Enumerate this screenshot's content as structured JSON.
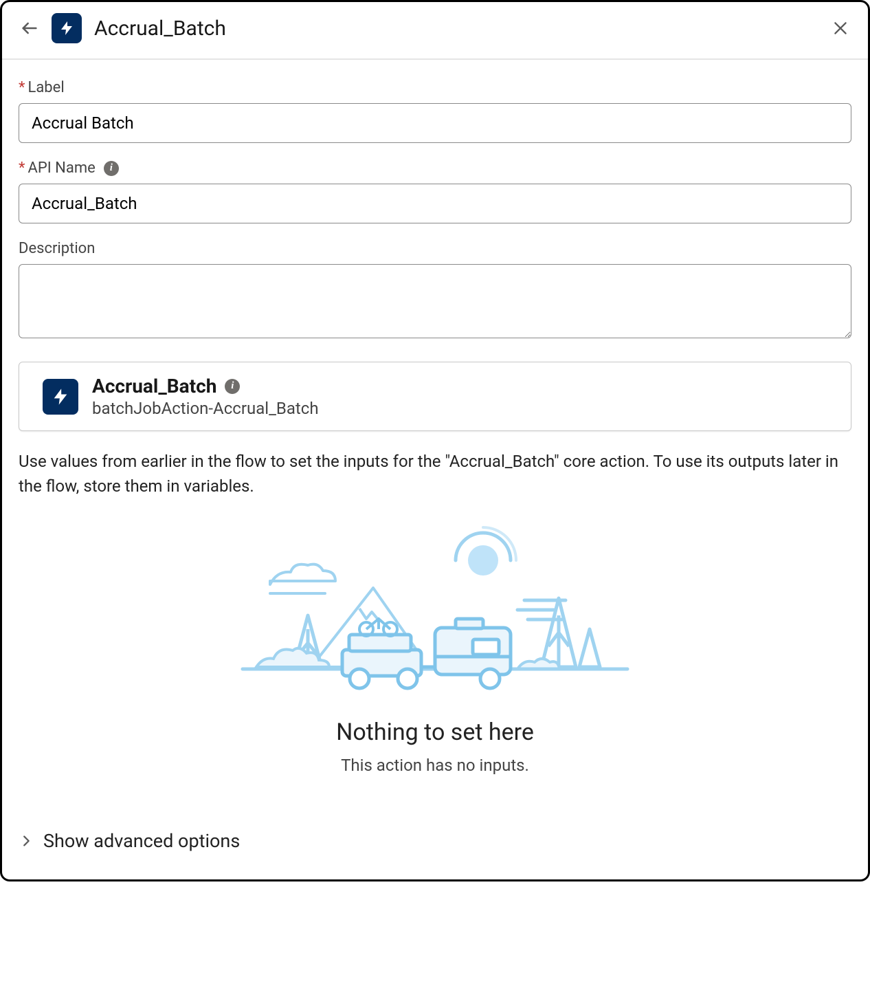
{
  "header": {
    "title": "Accrual_Batch"
  },
  "form": {
    "label": {
      "label": "Label",
      "value": "Accrual Batch",
      "required": true
    },
    "apiName": {
      "label": "API Name",
      "value": "Accrual_Batch",
      "required": true
    },
    "description": {
      "label": "Description",
      "value": ""
    }
  },
  "action": {
    "title": "Accrual_Batch",
    "subtitle": "batchJobAction-Accrual_Batch"
  },
  "helper": "Use values from earlier in the flow to set the inputs for the \"Accrual_Batch\" core action. To use its outputs later in the flow, store them in variables.",
  "empty": {
    "title": "Nothing to set here",
    "subtitle": "This action has no inputs."
  },
  "advanced": {
    "label": "Show advanced options"
  }
}
